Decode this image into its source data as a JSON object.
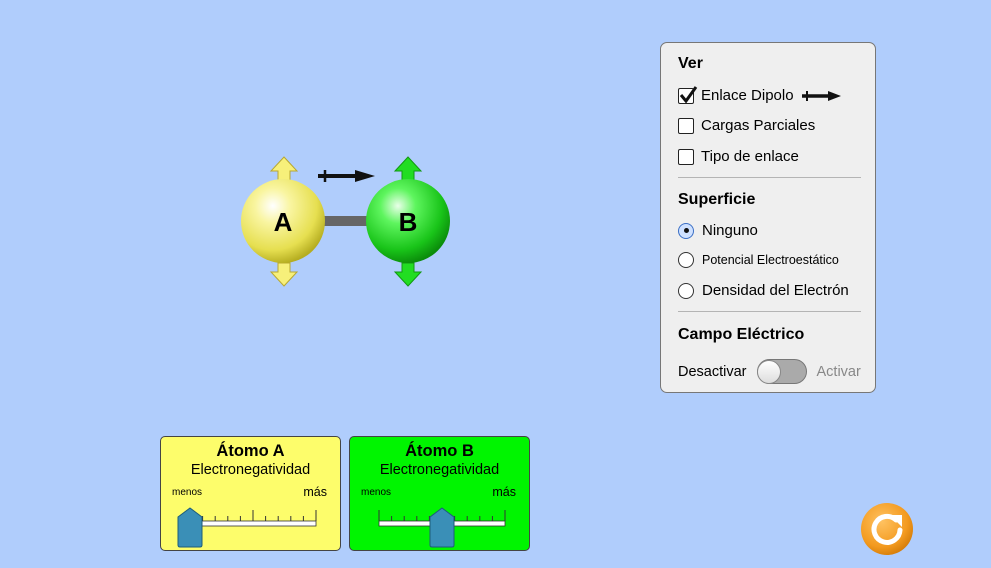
{
  "molecule": {
    "atom_a_label": "A",
    "atom_b_label": "B",
    "atom_a_color": "#f5f07a",
    "atom_b_color": "#2fe52f"
  },
  "panel": {
    "view_title": "Ver",
    "checkboxes": [
      {
        "label": "Enlace Dipolo",
        "checked": true
      },
      {
        "label": "Cargas Parciales",
        "checked": false
      },
      {
        "label": "Tipo de enlace",
        "checked": false
      }
    ],
    "surface_title": "Superficie",
    "radios": [
      {
        "label": "Ninguno",
        "selected": true
      },
      {
        "label": "Potencial Electroestático",
        "selected": false
      },
      {
        "label": "Densidad del Electrón",
        "selected": false
      }
    ],
    "field_title": "Campo Eléctrico",
    "toggle_off_label": "Desactivar",
    "toggle_on_label": "Activar",
    "field_active": false
  },
  "atom_a_panel": {
    "title": "Átomo A",
    "subtitle": "Electronegatividad",
    "low": "menos",
    "high": "más",
    "value": 0,
    "color": "#fdfd6b"
  },
  "atom_b_panel": {
    "title": "Átomo B",
    "subtitle": "Electronegatividad",
    "low": "menos",
    "high": "más",
    "value": 0.5,
    "color": "#00f500"
  },
  "colors": {
    "background": "#b0cdfc",
    "slider_thumb": "#3a8fb7",
    "reset_button": "#f39a1f"
  },
  "reset_icon": "reset-icon"
}
